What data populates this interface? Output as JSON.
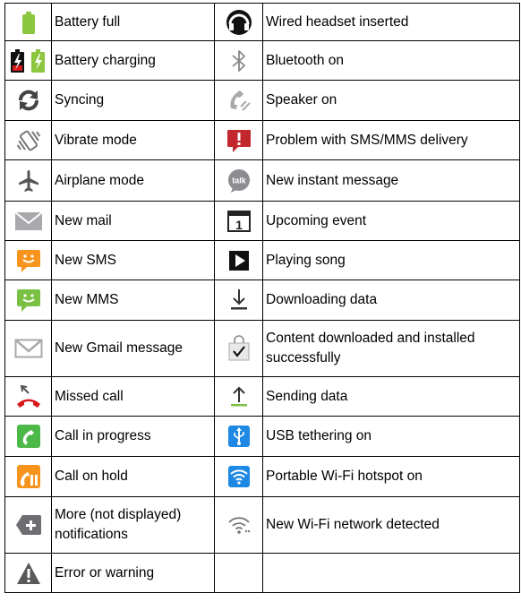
{
  "rows": [
    {
      "left": {
        "icon": "battery-full-icon",
        "label": "Battery full"
      },
      "right": {
        "icon": "wired-headset-icon",
        "label": "Wired headset inserted"
      }
    },
    {
      "left": {
        "icon": "battery-charging-icon",
        "label": "Battery charging"
      },
      "right": {
        "icon": "bluetooth-icon",
        "label": "Bluetooth on"
      }
    },
    {
      "left": {
        "icon": "sync-icon",
        "label": "Syncing"
      },
      "right": {
        "icon": "speaker-icon",
        "label": "Speaker on"
      }
    },
    {
      "left": {
        "icon": "vibrate-icon",
        "label": "Vibrate mode"
      },
      "right": {
        "icon": "sms-problem-icon",
        "label": "Problem with SMS/MMS delivery"
      }
    },
    {
      "left": {
        "icon": "airplane-icon",
        "label": "Airplane mode"
      },
      "right": {
        "icon": "talk-icon",
        "label": "New instant message",
        "icon_text": "talk"
      }
    },
    {
      "left": {
        "icon": "mail-icon",
        "label": "New mail"
      },
      "right": {
        "icon": "calendar-icon",
        "label": "Upcoming event",
        "icon_text": "1"
      }
    },
    {
      "left": {
        "icon": "sms-icon",
        "label": "New SMS"
      },
      "right": {
        "icon": "play-icon",
        "label": "Playing song"
      }
    },
    {
      "left": {
        "icon": "mms-icon",
        "label": "New MMS"
      },
      "right": {
        "icon": "download-icon",
        "label": "Downloading data"
      }
    },
    {
      "left": {
        "icon": "gmail-icon",
        "label": "New Gmail message"
      },
      "right": {
        "icon": "install-complete-icon",
        "label": "Content downloaded and installed successfully"
      }
    },
    {
      "left": {
        "icon": "missed-call-icon",
        "label": "Missed call"
      },
      "right": {
        "icon": "upload-icon",
        "label": "Sending data"
      }
    },
    {
      "left": {
        "icon": "call-in-progress-icon",
        "label": "Call in progress"
      },
      "right": {
        "icon": "usb-tethering-icon",
        "label": "USB tethering on"
      }
    },
    {
      "left": {
        "icon": "call-on-hold-icon",
        "label": "Call on hold"
      },
      "right": {
        "icon": "wifi-hotspot-icon",
        "label": "Portable Wi-Fi hotspot on"
      }
    },
    {
      "left": {
        "icon": "more-notifications-icon",
        "label": "More (not displayed) notifications"
      },
      "right": {
        "icon": "wifi-network-icon",
        "label": "New Wi-Fi network detected"
      }
    },
    {
      "left": {
        "icon": "warning-icon",
        "label": "Error or warning"
      },
      "right": {
        "icon": "",
        "label": ""
      }
    }
  ],
  "colors": {
    "battery_green": "#8cc63f",
    "orange": "#f7941d",
    "green_accent": "#7ac143",
    "red": "#d7191c",
    "blue": "#1e88e5",
    "grey": "#6d6e71"
  }
}
